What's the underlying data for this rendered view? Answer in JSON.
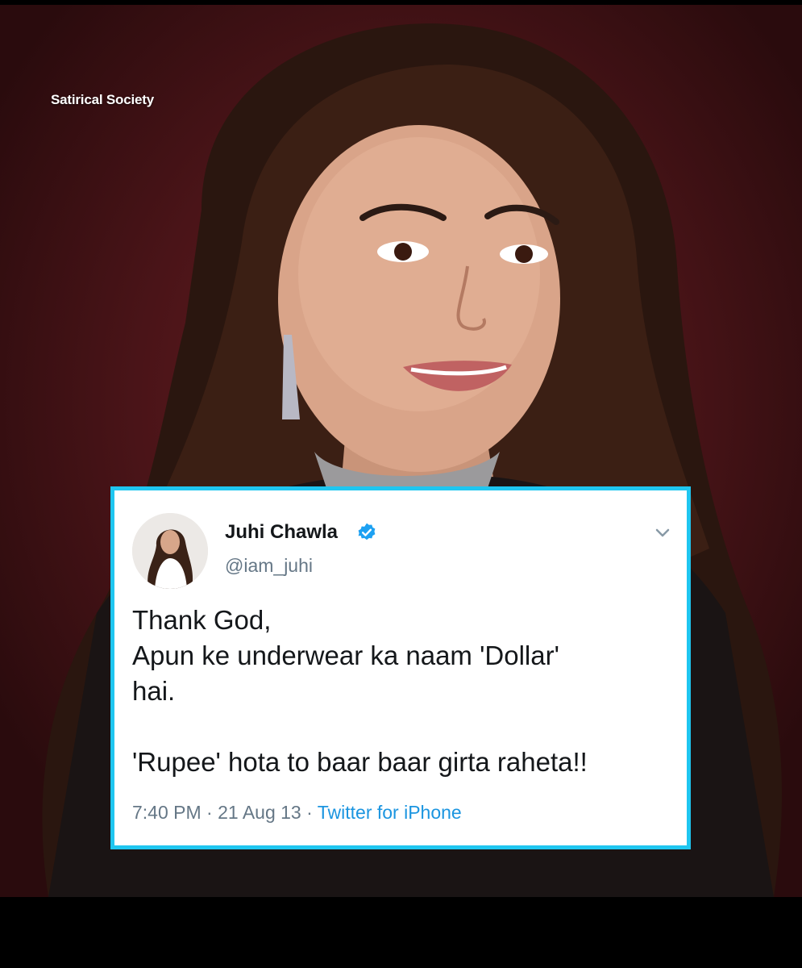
{
  "watermark": "Satirical Society",
  "tweet": {
    "display_name": "Juhi Chawla",
    "handle": "@iam_juhi",
    "verified": true,
    "text": "Thank God,\nApun ke underwear ka naam 'Dollar'\nhai.\n\n'Rupee' hota to baar baar girta raheta!!",
    "time": "7:40 PM",
    "separator": " · ",
    "date": "21 Aug 13",
    "source": "Twitter for iPhone"
  },
  "colors": {
    "card_border": "#1fc6f0",
    "verified_badge": "#1da1f2",
    "link": "#1b95e0",
    "background": "#6e1d22"
  }
}
